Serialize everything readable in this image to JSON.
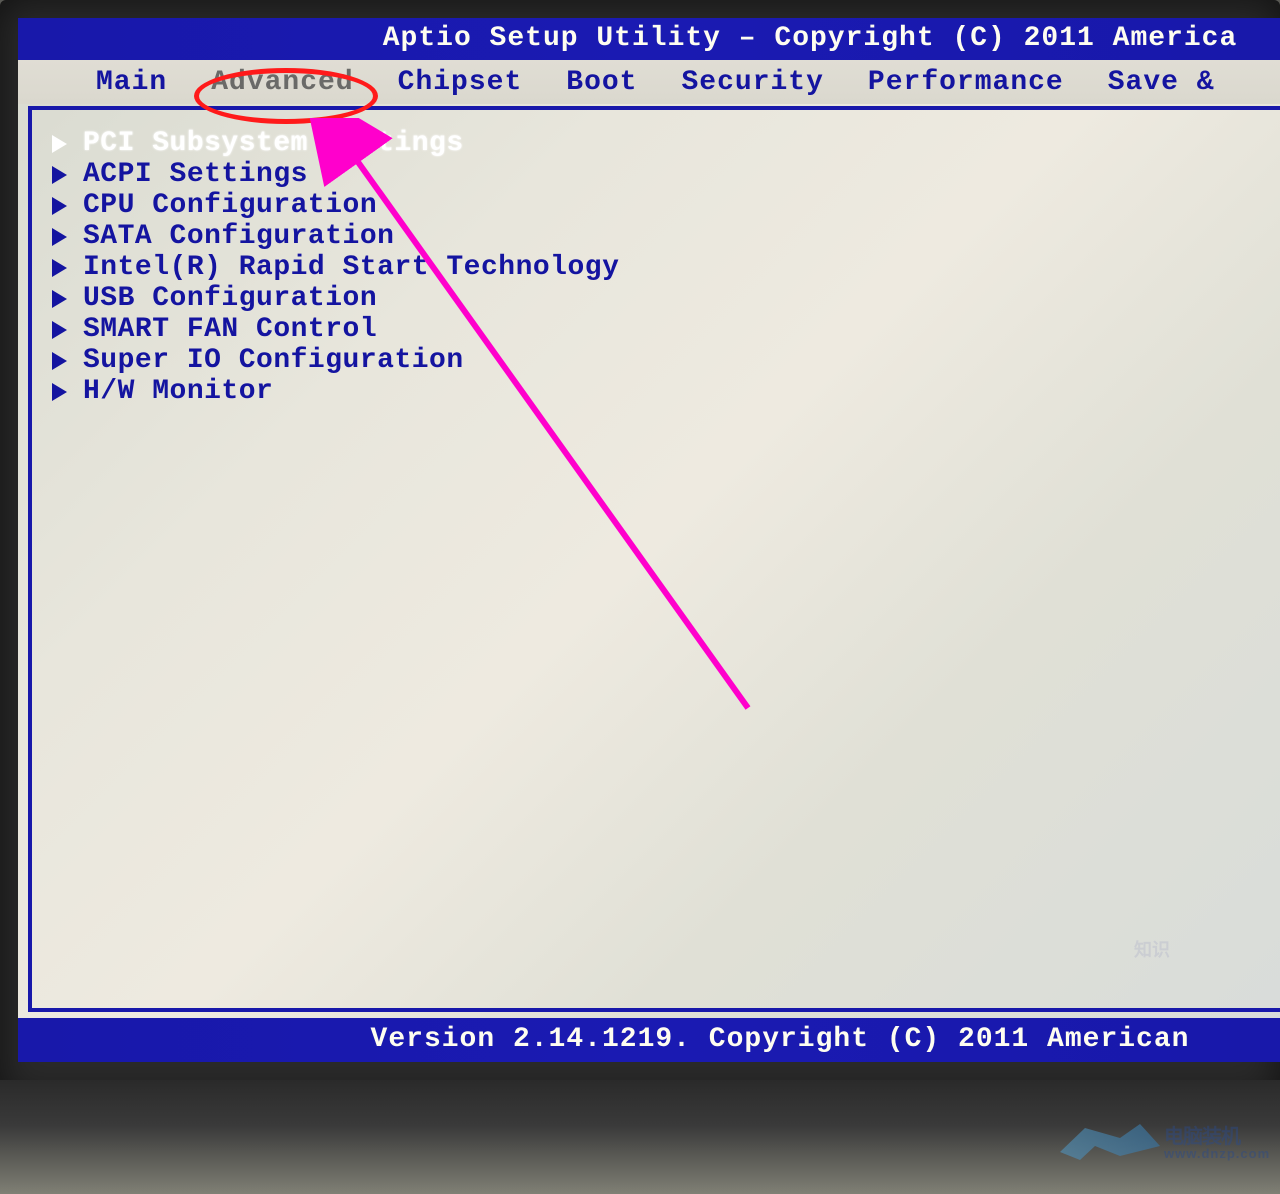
{
  "header": {
    "title": "Aptio Setup Utility – Copyright (C) 2011 America"
  },
  "tabs": [
    {
      "label": "Main",
      "active": false
    },
    {
      "label": "Advanced",
      "active": true
    },
    {
      "label": "Chipset",
      "active": false
    },
    {
      "label": "Boot",
      "active": false
    },
    {
      "label": "Security",
      "active": false
    },
    {
      "label": "Performance",
      "active": false
    },
    {
      "label": "Save &",
      "active": false
    }
  ],
  "menu": [
    {
      "label": "PCI Subsystem Settings",
      "selected": true
    },
    {
      "label": "ACPI Settings",
      "selected": false
    },
    {
      "label": "CPU Configuration",
      "selected": false
    },
    {
      "label": "SATA Configuration",
      "selected": false
    },
    {
      "label": "Intel(R) Rapid Start Technology",
      "selected": false
    },
    {
      "label": "USB Configuration",
      "selected": false
    },
    {
      "label": "SMART FAN Control",
      "selected": false
    },
    {
      "label": "Super IO Configuration",
      "selected": false
    },
    {
      "label": "H/W Monitor",
      "selected": false
    }
  ],
  "footer": {
    "text": "Version 2.14.1219. Copyright (C) 2011 American"
  },
  "annotations": {
    "circle_target": "Advanced",
    "arrow_color": "#ff00cc",
    "circle_color": "#ff1a1a"
  },
  "watermarks": {
    "brand1_top": "电脑装机",
    "brand1_bottom": "www.dnzp.com",
    "brand2": "知识"
  }
}
